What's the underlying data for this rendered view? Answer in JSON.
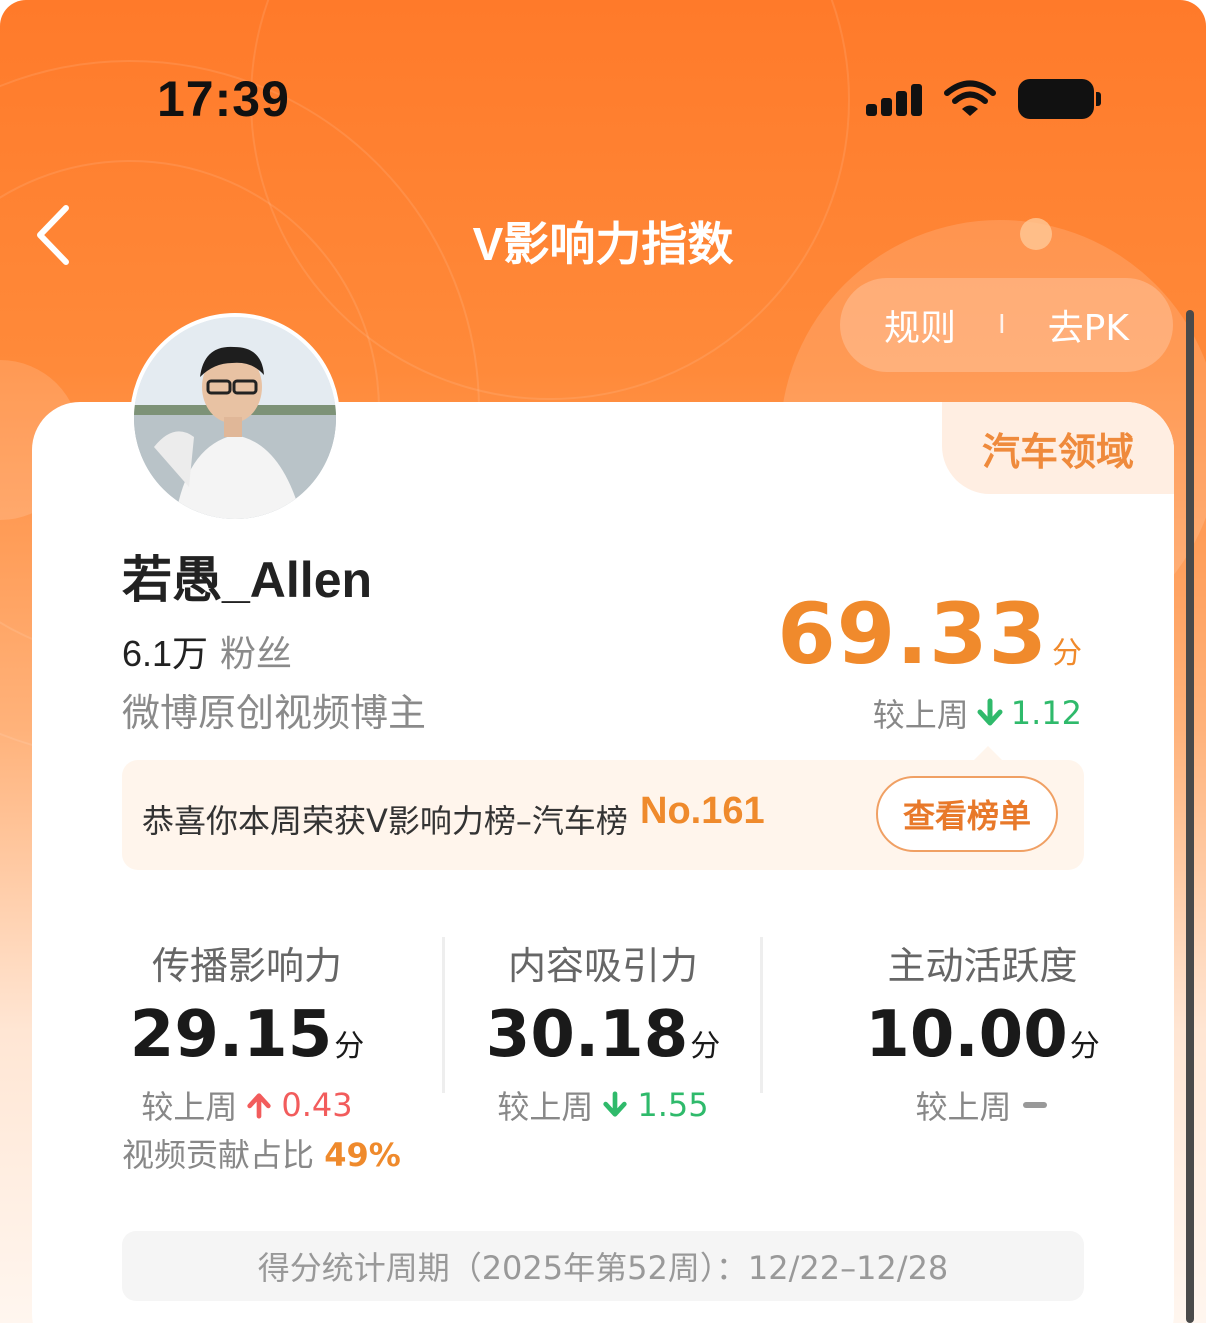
{
  "status_bar": {
    "time": "17:39"
  },
  "header": {
    "title": "V影响力指数",
    "rules_label": "规则",
    "separator": "I",
    "pk_label": "去PK"
  },
  "profile": {
    "domain_tag": "汽车领域",
    "username": "若愚_Allen",
    "fans_count": "6.1万",
    "fans_label": "粉丝",
    "bio": "微博原创视频博主"
  },
  "score": {
    "value": "69.33",
    "unit": "分",
    "compare_label": "较上周",
    "change": "1.12",
    "direction": "down"
  },
  "rank": {
    "text": "恭喜你本周荣获V影响力榜–汽车榜",
    "number": "No.161",
    "button_label": "查看榜单"
  },
  "metrics": [
    {
      "label": "传播影响力",
      "value": "29.15",
      "unit": "分",
      "compare_label": "较上周",
      "change": "0.43",
      "direction": "up"
    },
    {
      "label": "内容吸引力",
      "value": "30.18",
      "unit": "分",
      "compare_label": "较上周",
      "change": "1.55",
      "direction": "down"
    },
    {
      "label": "主动活跃度",
      "value": "10.00",
      "unit": "分",
      "compare_label": "较上周",
      "change": "",
      "direction": "flat"
    }
  ],
  "video_ratio": {
    "label": "视频贡献占比",
    "value": "49%"
  },
  "period": {
    "text": "得分统计周期（2025年第52周）：12/22–12/28"
  },
  "colors": {
    "accent": "#ff7a2a",
    "score_orange": "#f08a2c",
    "down_green": "#2fba6b",
    "up_red": "#f25c5c"
  }
}
